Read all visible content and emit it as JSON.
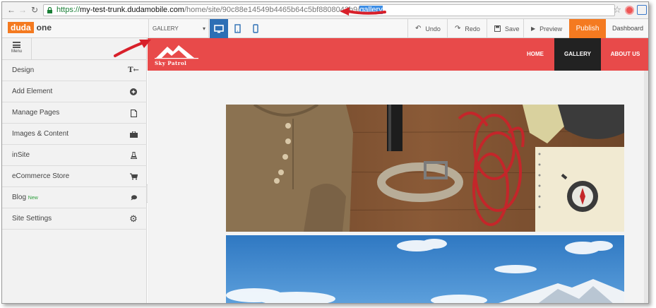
{
  "browser": {
    "url_proto": "https://",
    "url_host": "my-test-trunk.dudamobile.com",
    "url_path": "/home/site/90c88e14549b4465b64c5bf8808043b9/",
    "url_selected": "gallery"
  },
  "toolbar": {
    "logo_brand": "duda",
    "logo_suffix": "one",
    "page_select": "GALLERY",
    "undo": "Undo",
    "redo": "Redo",
    "save": "Save",
    "preview": "Preview",
    "publish": "Publish",
    "dashboard": "Dashboard"
  },
  "sidebar": {
    "menu_label": "Menu",
    "items": [
      {
        "label": "Design",
        "icon": "text-format-icon"
      },
      {
        "label": "Add Element",
        "icon": "plus-circle-icon"
      },
      {
        "label": "Manage Pages",
        "icon": "page-icon"
      },
      {
        "label": "Images & Content",
        "icon": "briefcase-icon"
      },
      {
        "label": "inSite",
        "icon": "flask-icon"
      },
      {
        "label": "eCommerce Store",
        "icon": "cart-icon"
      },
      {
        "label": "Blog",
        "badge": "New",
        "icon": "comment-icon"
      },
      {
        "label": "Site Settings",
        "icon": "gear-icon"
      }
    ]
  },
  "site": {
    "logo_text": "Sky Patrol",
    "nav": [
      "HOME",
      "GALLERY",
      "ABOUT US"
    ],
    "active_nav": "GALLERY"
  },
  "colors": {
    "accent_orange": "#f47a20",
    "header_red": "#e84a4a",
    "device_active": "#2d6fb5",
    "annotation_red": "#d8202a"
  }
}
